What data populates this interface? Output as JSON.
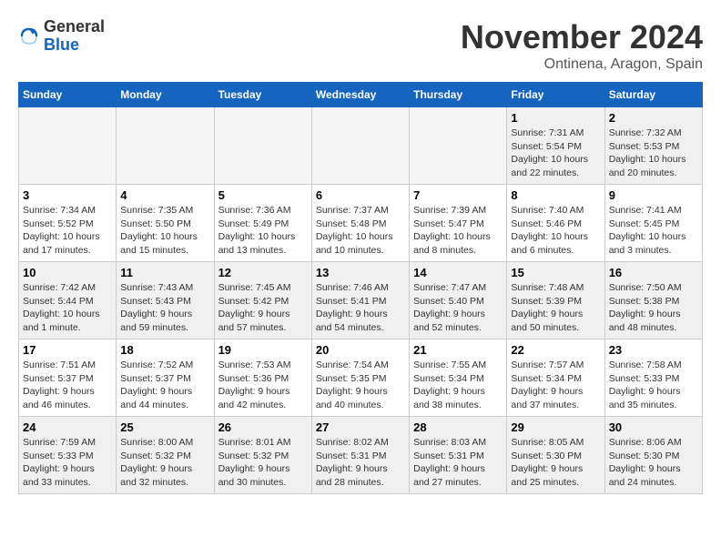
{
  "logo": {
    "general": "General",
    "blue": "Blue"
  },
  "title": "November 2024",
  "location": "Ontinena, Aragon, Spain",
  "days_header": [
    "Sunday",
    "Monday",
    "Tuesday",
    "Wednesday",
    "Thursday",
    "Friday",
    "Saturday"
  ],
  "weeks": [
    [
      {
        "day": "",
        "info": ""
      },
      {
        "day": "",
        "info": ""
      },
      {
        "day": "",
        "info": ""
      },
      {
        "day": "",
        "info": ""
      },
      {
        "day": "",
        "info": ""
      },
      {
        "day": "1",
        "info": "Sunrise: 7:31 AM\nSunset: 5:54 PM\nDaylight: 10 hours and 22 minutes."
      },
      {
        "day": "2",
        "info": "Sunrise: 7:32 AM\nSunset: 5:53 PM\nDaylight: 10 hours and 20 minutes."
      }
    ],
    [
      {
        "day": "3",
        "info": "Sunrise: 7:34 AM\nSunset: 5:52 PM\nDaylight: 10 hours and 17 minutes."
      },
      {
        "day": "4",
        "info": "Sunrise: 7:35 AM\nSunset: 5:50 PM\nDaylight: 10 hours and 15 minutes."
      },
      {
        "day": "5",
        "info": "Sunrise: 7:36 AM\nSunset: 5:49 PM\nDaylight: 10 hours and 13 minutes."
      },
      {
        "day": "6",
        "info": "Sunrise: 7:37 AM\nSunset: 5:48 PM\nDaylight: 10 hours and 10 minutes."
      },
      {
        "day": "7",
        "info": "Sunrise: 7:39 AM\nSunset: 5:47 PM\nDaylight: 10 hours and 8 minutes."
      },
      {
        "day": "8",
        "info": "Sunrise: 7:40 AM\nSunset: 5:46 PM\nDaylight: 10 hours and 6 minutes."
      },
      {
        "day": "9",
        "info": "Sunrise: 7:41 AM\nSunset: 5:45 PM\nDaylight: 10 hours and 3 minutes."
      }
    ],
    [
      {
        "day": "10",
        "info": "Sunrise: 7:42 AM\nSunset: 5:44 PM\nDaylight: 10 hours and 1 minute."
      },
      {
        "day": "11",
        "info": "Sunrise: 7:43 AM\nSunset: 5:43 PM\nDaylight: 9 hours and 59 minutes."
      },
      {
        "day": "12",
        "info": "Sunrise: 7:45 AM\nSunset: 5:42 PM\nDaylight: 9 hours and 57 minutes."
      },
      {
        "day": "13",
        "info": "Sunrise: 7:46 AM\nSunset: 5:41 PM\nDaylight: 9 hours and 54 minutes."
      },
      {
        "day": "14",
        "info": "Sunrise: 7:47 AM\nSunset: 5:40 PM\nDaylight: 9 hours and 52 minutes."
      },
      {
        "day": "15",
        "info": "Sunrise: 7:48 AM\nSunset: 5:39 PM\nDaylight: 9 hours and 50 minutes."
      },
      {
        "day": "16",
        "info": "Sunrise: 7:50 AM\nSunset: 5:38 PM\nDaylight: 9 hours and 48 minutes."
      }
    ],
    [
      {
        "day": "17",
        "info": "Sunrise: 7:51 AM\nSunset: 5:37 PM\nDaylight: 9 hours and 46 minutes."
      },
      {
        "day": "18",
        "info": "Sunrise: 7:52 AM\nSunset: 5:37 PM\nDaylight: 9 hours and 44 minutes."
      },
      {
        "day": "19",
        "info": "Sunrise: 7:53 AM\nSunset: 5:36 PM\nDaylight: 9 hours and 42 minutes."
      },
      {
        "day": "20",
        "info": "Sunrise: 7:54 AM\nSunset: 5:35 PM\nDaylight: 9 hours and 40 minutes."
      },
      {
        "day": "21",
        "info": "Sunrise: 7:55 AM\nSunset: 5:34 PM\nDaylight: 9 hours and 38 minutes."
      },
      {
        "day": "22",
        "info": "Sunrise: 7:57 AM\nSunset: 5:34 PM\nDaylight: 9 hours and 37 minutes."
      },
      {
        "day": "23",
        "info": "Sunrise: 7:58 AM\nSunset: 5:33 PM\nDaylight: 9 hours and 35 minutes."
      }
    ],
    [
      {
        "day": "24",
        "info": "Sunrise: 7:59 AM\nSunset: 5:33 PM\nDaylight: 9 hours and 33 minutes."
      },
      {
        "day": "25",
        "info": "Sunrise: 8:00 AM\nSunset: 5:32 PM\nDaylight: 9 hours and 32 minutes."
      },
      {
        "day": "26",
        "info": "Sunrise: 8:01 AM\nSunset: 5:32 PM\nDaylight: 9 hours and 30 minutes."
      },
      {
        "day": "27",
        "info": "Sunrise: 8:02 AM\nSunset: 5:31 PM\nDaylight: 9 hours and 28 minutes."
      },
      {
        "day": "28",
        "info": "Sunrise: 8:03 AM\nSunset: 5:31 PM\nDaylight: 9 hours and 27 minutes."
      },
      {
        "day": "29",
        "info": "Sunrise: 8:05 AM\nSunset: 5:30 PM\nDaylight: 9 hours and 25 minutes."
      },
      {
        "day": "30",
        "info": "Sunrise: 8:06 AM\nSunset: 5:30 PM\nDaylight: 9 hours and 24 minutes."
      }
    ]
  ]
}
